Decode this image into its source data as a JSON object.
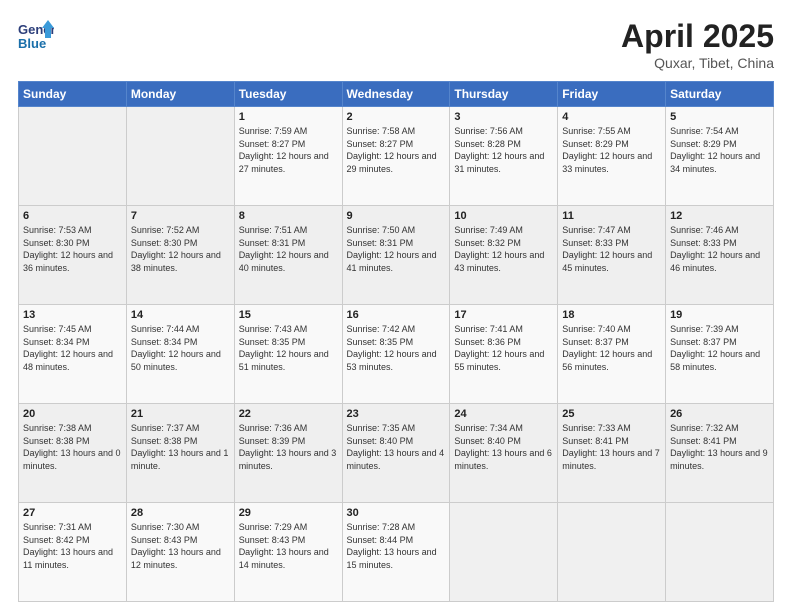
{
  "logo": {
    "line1": "General",
    "line2": "Blue"
  },
  "title": "April 2025",
  "subtitle": "Quxar, Tibet, China",
  "weekdays": [
    "Sunday",
    "Monday",
    "Tuesday",
    "Wednesday",
    "Thursday",
    "Friday",
    "Saturday"
  ],
  "weeks": [
    [
      {
        "day": "",
        "info": ""
      },
      {
        "day": "",
        "info": ""
      },
      {
        "day": "1",
        "info": "Sunrise: 7:59 AM\nSunset: 8:27 PM\nDaylight: 12 hours and 27 minutes."
      },
      {
        "day": "2",
        "info": "Sunrise: 7:58 AM\nSunset: 8:27 PM\nDaylight: 12 hours and 29 minutes."
      },
      {
        "day": "3",
        "info": "Sunrise: 7:56 AM\nSunset: 8:28 PM\nDaylight: 12 hours and 31 minutes."
      },
      {
        "day": "4",
        "info": "Sunrise: 7:55 AM\nSunset: 8:29 PM\nDaylight: 12 hours and 33 minutes."
      },
      {
        "day": "5",
        "info": "Sunrise: 7:54 AM\nSunset: 8:29 PM\nDaylight: 12 hours and 34 minutes."
      }
    ],
    [
      {
        "day": "6",
        "info": "Sunrise: 7:53 AM\nSunset: 8:30 PM\nDaylight: 12 hours and 36 minutes."
      },
      {
        "day": "7",
        "info": "Sunrise: 7:52 AM\nSunset: 8:30 PM\nDaylight: 12 hours and 38 minutes."
      },
      {
        "day": "8",
        "info": "Sunrise: 7:51 AM\nSunset: 8:31 PM\nDaylight: 12 hours and 40 minutes."
      },
      {
        "day": "9",
        "info": "Sunrise: 7:50 AM\nSunset: 8:31 PM\nDaylight: 12 hours and 41 minutes."
      },
      {
        "day": "10",
        "info": "Sunrise: 7:49 AM\nSunset: 8:32 PM\nDaylight: 12 hours and 43 minutes."
      },
      {
        "day": "11",
        "info": "Sunrise: 7:47 AM\nSunset: 8:33 PM\nDaylight: 12 hours and 45 minutes."
      },
      {
        "day": "12",
        "info": "Sunrise: 7:46 AM\nSunset: 8:33 PM\nDaylight: 12 hours and 46 minutes."
      }
    ],
    [
      {
        "day": "13",
        "info": "Sunrise: 7:45 AM\nSunset: 8:34 PM\nDaylight: 12 hours and 48 minutes."
      },
      {
        "day": "14",
        "info": "Sunrise: 7:44 AM\nSunset: 8:34 PM\nDaylight: 12 hours and 50 minutes."
      },
      {
        "day": "15",
        "info": "Sunrise: 7:43 AM\nSunset: 8:35 PM\nDaylight: 12 hours and 51 minutes."
      },
      {
        "day": "16",
        "info": "Sunrise: 7:42 AM\nSunset: 8:35 PM\nDaylight: 12 hours and 53 minutes."
      },
      {
        "day": "17",
        "info": "Sunrise: 7:41 AM\nSunset: 8:36 PM\nDaylight: 12 hours and 55 minutes."
      },
      {
        "day": "18",
        "info": "Sunrise: 7:40 AM\nSunset: 8:37 PM\nDaylight: 12 hours and 56 minutes."
      },
      {
        "day": "19",
        "info": "Sunrise: 7:39 AM\nSunset: 8:37 PM\nDaylight: 12 hours and 58 minutes."
      }
    ],
    [
      {
        "day": "20",
        "info": "Sunrise: 7:38 AM\nSunset: 8:38 PM\nDaylight: 13 hours and 0 minutes."
      },
      {
        "day": "21",
        "info": "Sunrise: 7:37 AM\nSunset: 8:38 PM\nDaylight: 13 hours and 1 minute."
      },
      {
        "day": "22",
        "info": "Sunrise: 7:36 AM\nSunset: 8:39 PM\nDaylight: 13 hours and 3 minutes."
      },
      {
        "day": "23",
        "info": "Sunrise: 7:35 AM\nSunset: 8:40 PM\nDaylight: 13 hours and 4 minutes."
      },
      {
        "day": "24",
        "info": "Sunrise: 7:34 AM\nSunset: 8:40 PM\nDaylight: 13 hours and 6 minutes."
      },
      {
        "day": "25",
        "info": "Sunrise: 7:33 AM\nSunset: 8:41 PM\nDaylight: 13 hours and 7 minutes."
      },
      {
        "day": "26",
        "info": "Sunrise: 7:32 AM\nSunset: 8:41 PM\nDaylight: 13 hours and 9 minutes."
      }
    ],
    [
      {
        "day": "27",
        "info": "Sunrise: 7:31 AM\nSunset: 8:42 PM\nDaylight: 13 hours and 11 minutes."
      },
      {
        "day": "28",
        "info": "Sunrise: 7:30 AM\nSunset: 8:43 PM\nDaylight: 13 hours and 12 minutes."
      },
      {
        "day": "29",
        "info": "Sunrise: 7:29 AM\nSunset: 8:43 PM\nDaylight: 13 hours and 14 minutes."
      },
      {
        "day": "30",
        "info": "Sunrise: 7:28 AM\nSunset: 8:44 PM\nDaylight: 13 hours and 15 minutes."
      },
      {
        "day": "",
        "info": ""
      },
      {
        "day": "",
        "info": ""
      },
      {
        "day": "",
        "info": ""
      }
    ]
  ]
}
